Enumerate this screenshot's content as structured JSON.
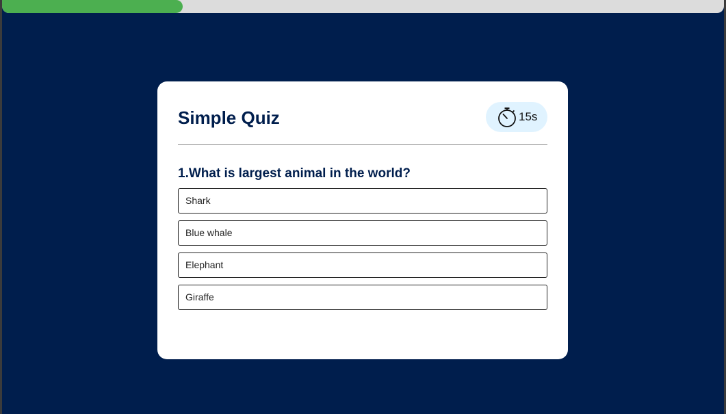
{
  "progress": {
    "fraction": 0.25,
    "color": "#4caf50"
  },
  "quiz": {
    "title": "Simple Quiz",
    "timer": {
      "icon": "stopwatch-icon",
      "text": "15s"
    },
    "question": "1.What is largest animal in the world?",
    "options": [
      "Shark",
      "Blue whale",
      "Elephant",
      "Giraffe"
    ]
  },
  "colors": {
    "background": "#001e4d",
    "card": "#ffffff",
    "timer_bg": "#e0f3ff",
    "heading": "#001e4d"
  }
}
